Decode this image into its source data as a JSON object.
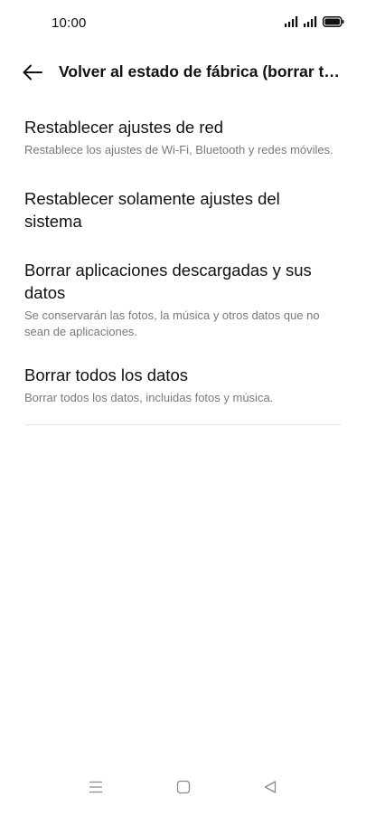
{
  "status_bar": {
    "time": "10:00",
    "icons": [
      "signal-icon",
      "signal-icon",
      "battery-icon"
    ]
  },
  "header": {
    "back_icon": "arrow-left-icon",
    "title": "Volver al estado de fábrica (borrar to…"
  },
  "items": [
    {
      "title": "Restablecer ajustes de red",
      "description": "Restablece los ajustes de Wi-Fi, Bluetooth y redes móviles."
    },
    {
      "title": "Restablecer solamente ajustes del sistema",
      "description": ""
    },
    {
      "title": "Borrar aplicaciones descargadas y sus datos",
      "description": "Se conservarán las fotos, la música y otros datos que no sean de aplicaciones."
    },
    {
      "title": "Borrar todos los datos",
      "description": "Borrar todos los datos, incluidas fotos y música."
    }
  ],
  "nav_bar": {
    "icons": [
      "menu-icon",
      "home-icon",
      "back-triangle-icon"
    ]
  },
  "colors": {
    "background": "#ffffff",
    "text_primary": "#111111",
    "text_secondary": "#7a7a7a",
    "divider": "#e6e6e6"
  }
}
